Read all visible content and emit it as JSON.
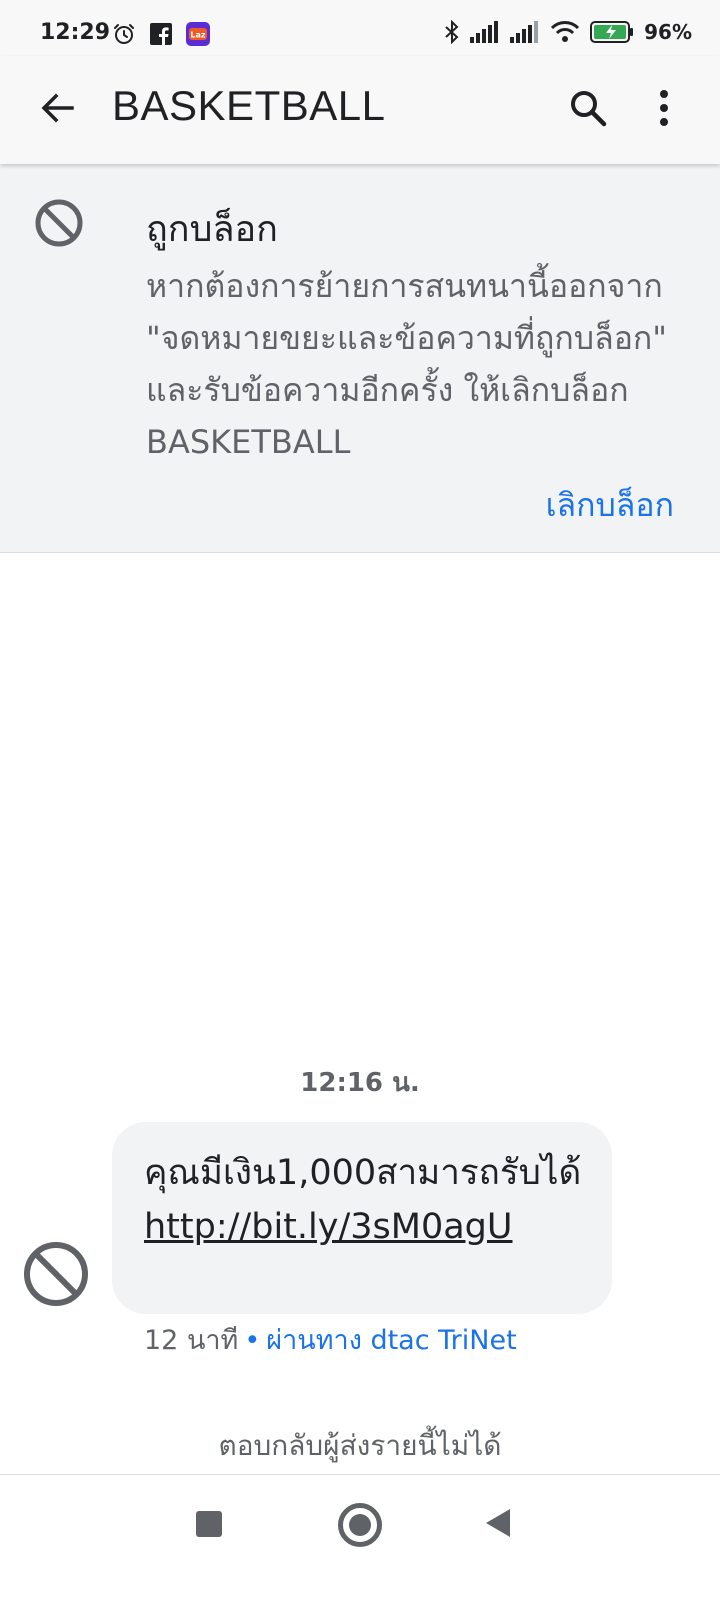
{
  "status_bar": {
    "time": "12:29",
    "battery_percent": "96%",
    "left_icons": [
      "alarm-icon",
      "facebook-icon",
      "lazada-icon"
    ],
    "right_icons": [
      "bluetooth-icon",
      "signal-icon",
      "signal-icon",
      "wifi-icon",
      "battery-charging-icon"
    ],
    "battery_level": 0.96
  },
  "app_bar": {
    "title": "BASKETBALL",
    "icons": [
      "back-arrow-icon",
      "search-icon",
      "more-vert-icon"
    ]
  },
  "blocked_banner": {
    "icon": "block-icon",
    "title": "ถูกบล็อก",
    "body": "หากต้องการย้ายการสนทนานี้ออกจาก \"จดหมายขยะและข้อความที่ถูกบล็อก\" และรับข้อความอีกครั้ง ให้เลิกบล็อก BASKETBALL",
    "unblock_label": "เลิกบล็อก",
    "accent_color": "#1a73e8"
  },
  "conversation": {
    "timestamp": "12:16 น.",
    "messages": [
      {
        "text": "คุณมีเงิน1,000สามารถรับได้ ",
        "link": "http://bit.ly/3sM0agU",
        "age": "12 นาที",
        "separator": "•",
        "via": "ผ่านทาง dtac TriNet",
        "avatar_icon": "block-icon"
      }
    ]
  },
  "footer": {
    "cannot_reply": "ตอบกลับผู้ส่งรายนี้ไม่ได้"
  },
  "nav_bar": {
    "icons": [
      "recents-square-icon",
      "home-circle-icon",
      "back-triangle-icon"
    ]
  }
}
